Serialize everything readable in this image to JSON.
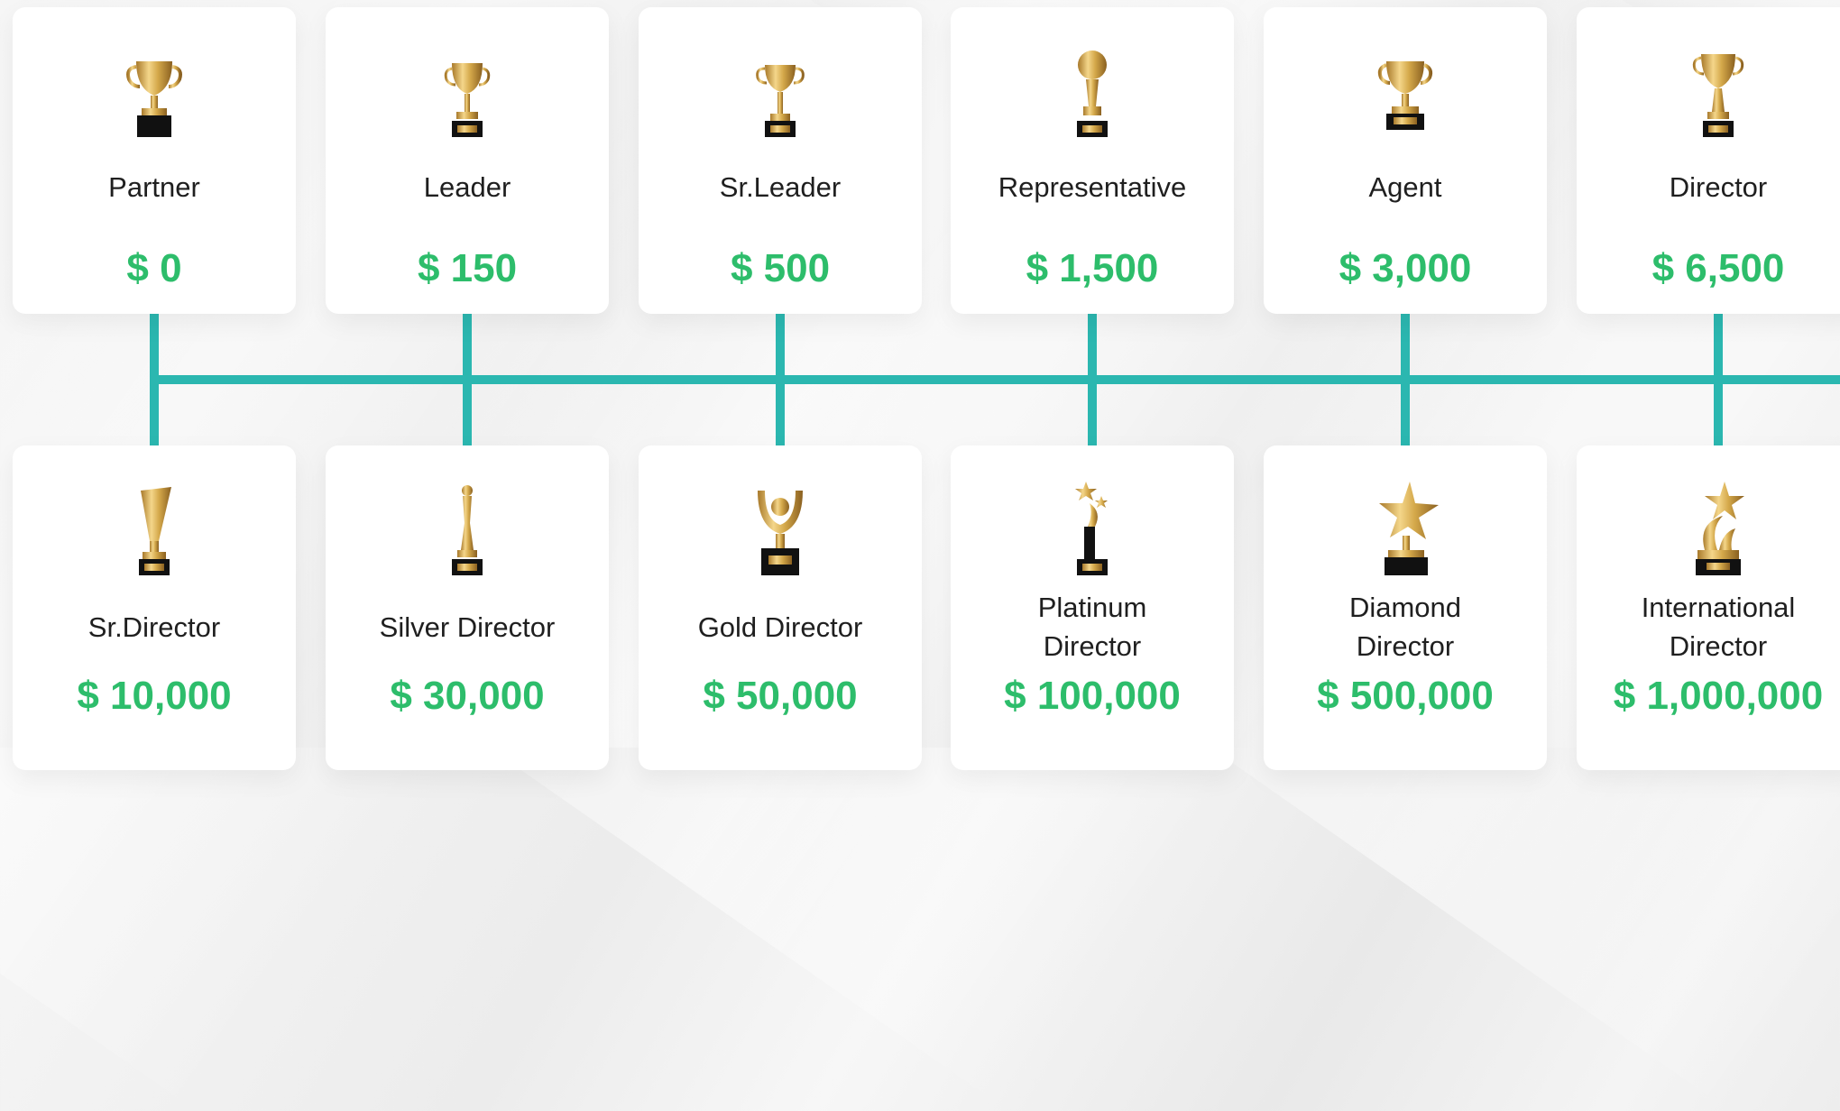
{
  "colors": {
    "accent_green": "#2dbd6b",
    "connector_teal": "#2bb7b0",
    "trophy_gold": "#d4a84a",
    "card_bg": "#ffffff"
  },
  "top_row": [
    {
      "title": "Partner",
      "amount": "$ 0",
      "icon": "trophy-cup-icon"
    },
    {
      "title": "Leader",
      "amount": "$ 150",
      "icon": "trophy-cup-icon"
    },
    {
      "title": "Sr.Leader",
      "amount": "$ 500",
      "icon": "trophy-cup-icon"
    },
    {
      "title": "Representative",
      "amount": "$ 1,500",
      "icon": "trophy-globe-icon"
    },
    {
      "title": "Agent",
      "amount": "$ 3,000",
      "icon": "trophy-cup-icon"
    },
    {
      "title": "Director",
      "amount": "$ 6,500",
      "icon": "trophy-cup-icon"
    }
  ],
  "bottom_row": [
    {
      "title": "Sr.Director",
      "amount": "$ 10,000",
      "icon": "trophy-cone-icon"
    },
    {
      "title": "Silver Director",
      "amount": "$ 30,000",
      "icon": "trophy-figure-icon"
    },
    {
      "title": "Gold Director",
      "amount": "$ 50,000",
      "icon": "trophy-bowl-icon"
    },
    {
      "title": "Platinum Director",
      "amount": "$ 100,000",
      "icon": "trophy-stars-icon"
    },
    {
      "title": "Diamond Director",
      "amount": "$ 500,000",
      "icon": "trophy-star-icon"
    },
    {
      "title": "International Director",
      "amount": "$ 1,000,000",
      "icon": "trophy-star-swirl-icon"
    }
  ]
}
